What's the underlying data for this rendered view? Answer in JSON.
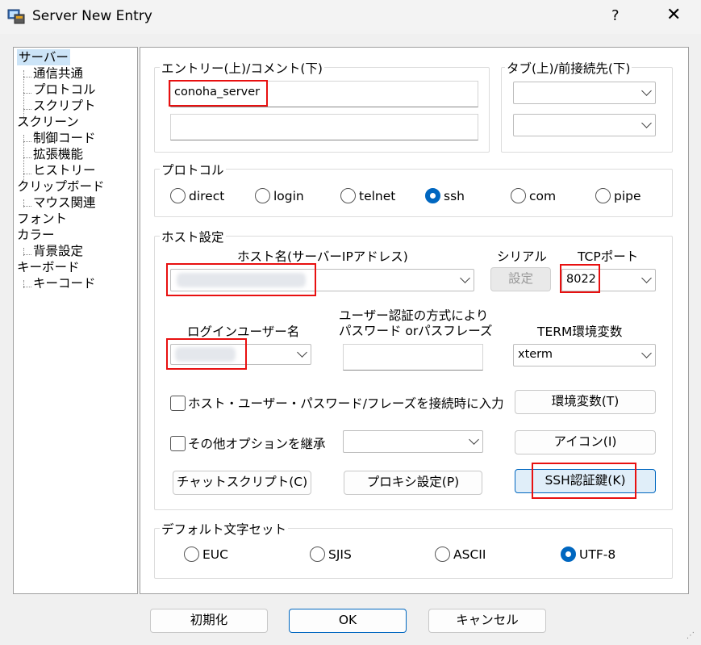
{
  "window": {
    "title": "Server New Entry",
    "help_label": "?",
    "close_label": "✕"
  },
  "tree": {
    "items": [
      {
        "label": "サーバー"
      },
      {
        "label": "通信共通"
      },
      {
        "label": "プロトコル"
      },
      {
        "label": "スクリプト"
      },
      {
        "label": "スクリーン"
      },
      {
        "label": "制御コード"
      },
      {
        "label": "拡張機能"
      },
      {
        "label": "ヒストリー"
      },
      {
        "label": "クリップボード"
      },
      {
        "label": "マウス関連"
      },
      {
        "label": "フォント"
      },
      {
        "label": "カラー"
      },
      {
        "label": "背景設定"
      },
      {
        "label": "キーボード"
      },
      {
        "label": "キーコード"
      }
    ]
  },
  "entry": {
    "group_label": "エントリー(上)/コメント(下)",
    "name_value": "conoha_server",
    "comment_value": ""
  },
  "tab": {
    "group_label": "タブ(上)/前接続先(下)",
    "tab_value": "",
    "prev_value": ""
  },
  "protocol": {
    "group_label": "プロトコル",
    "options": [
      {
        "label": "direct",
        "selected": false
      },
      {
        "label": "login",
        "selected": false
      },
      {
        "label": "telnet",
        "selected": false
      },
      {
        "label": "ssh",
        "selected": true
      },
      {
        "label": "com",
        "selected": false
      },
      {
        "label": "pipe",
        "selected": false
      }
    ]
  },
  "host": {
    "group_label": "ホスト設定",
    "hostname_label": "ホスト名(サーバーIPアドレス)",
    "serial_label": "シリアル",
    "serial_button": "設定",
    "tcp_label": "TCPポート",
    "tcp_value": "8022",
    "login_label": "ログインユーザー名",
    "auth_label_1": "ユーザー認証の方式により",
    "auth_label_2": "パスワード orパスフレーズ",
    "term_label": "TERM環境変数",
    "term_value": "xterm",
    "check_input_label": "ホスト・ユーザー・パスワード/フレーズを接続時に入力",
    "env_button": "環境変数(T)",
    "check_inherit_label": "その他オプションを継承",
    "icon_button": "アイコン(I)",
    "chat_button": "チャットスクリプト(C)",
    "proxy_button": "プロキシ設定(P)",
    "ssh_key_button": "SSH認証鍵(K)"
  },
  "charset": {
    "group_label": "デフォルト文字セット",
    "options": [
      {
        "label": "EUC",
        "selected": false
      },
      {
        "label": "SJIS",
        "selected": false
      },
      {
        "label": "ASCII",
        "selected": false
      },
      {
        "label": "UTF-8",
        "selected": true
      }
    ]
  },
  "footer": {
    "init_button": "初期化",
    "ok_button": "OK",
    "cancel_button": "キャンセル"
  },
  "colors": {
    "accent": "#0067c0",
    "highlight": "#e81010",
    "selection": "#cce4f7"
  }
}
